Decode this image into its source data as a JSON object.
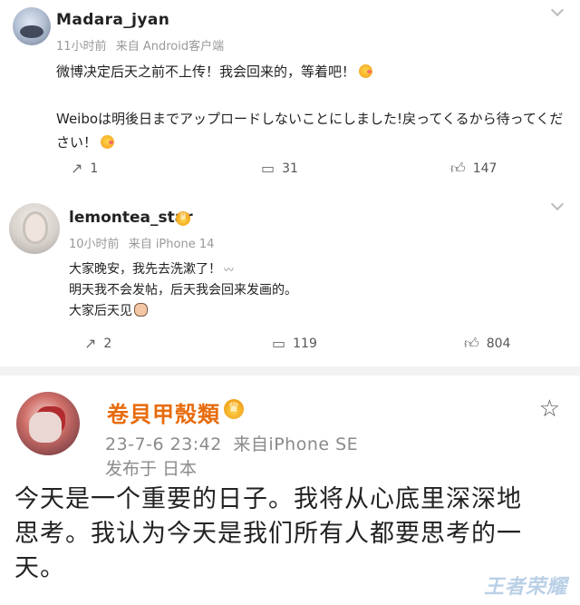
{
  "posts": [
    {
      "username": "Madara_jyan",
      "time": "11小时前",
      "source": "来自 Android客户端",
      "lines": [
        "微博决定后天之前不上传！我会回来的，等着吧！",
        "Weiboは明後日までアップロードしないことにしました!戻ってくるから待ってください！"
      ],
      "shares": "1",
      "comments": "31",
      "likes": "147"
    },
    {
      "username": "lemontea_star",
      "time": "10小时前",
      "source": "来自 iPhone 14",
      "lines": [
        "大家晚安，我先去洗漱了！",
        "明天我不会发帖，后天我会回来发画的。",
        "大家后天见"
      ],
      "shares": "2",
      "comments": "119",
      "likes": "804"
    },
    {
      "username": "卷貝甲殼類",
      "time": "23-7-6 23:42",
      "source": "来自iPhone SE",
      "location": "发布于 日本",
      "lines": [
        "今天是一个重要的日子。我将从心底里深深地",
        "思考。我认为今天是我们所有人都要思考的一",
        "天。"
      ]
    }
  ],
  "icons": {
    "share": "share-icon",
    "comment": "comment-icon",
    "like": "like-icon",
    "star": "star-icon",
    "verified": "crown-badge-icon"
  },
  "colors": {
    "vip_name": "#e86b0c",
    "meta_gray": "#999999",
    "badge_gold": "#f1a21c"
  },
  "watermark": "王者荣耀"
}
